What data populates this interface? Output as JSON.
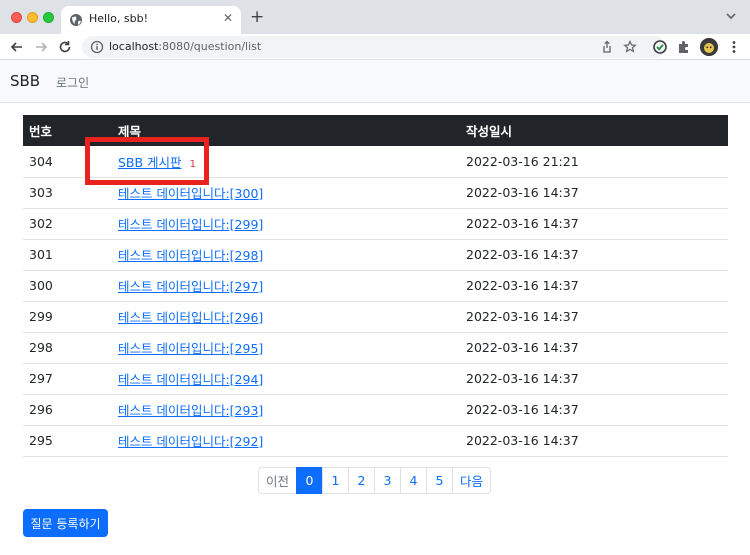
{
  "browser": {
    "tab_title": "Hello, sbb!",
    "tab_close": "✕",
    "new_tab": "+",
    "url_host": "localhost",
    "url_path": ":8080/question/list"
  },
  "navbar": {
    "brand": "SBB",
    "login": "로그인"
  },
  "table": {
    "headers": {
      "number": "번호",
      "subject": "제목",
      "created": "작성일시"
    },
    "rows": [
      {
        "number": "304",
        "subject": "SBB 게시판",
        "answers": "1",
        "created": "2022-03-16 21:21"
      },
      {
        "number": "303",
        "subject": "테스트 데이터입니다:[300]",
        "answers": "",
        "created": "2022-03-16 14:37"
      },
      {
        "number": "302",
        "subject": "테스트 데이터입니다:[299]",
        "answers": "",
        "created": "2022-03-16 14:37"
      },
      {
        "number": "301",
        "subject": "테스트 데이터입니다:[298]",
        "answers": "",
        "created": "2022-03-16 14:37"
      },
      {
        "number": "300",
        "subject": "테스트 데이터입니다:[297]",
        "answers": "",
        "created": "2022-03-16 14:37"
      },
      {
        "number": "299",
        "subject": "테스트 데이터입니다:[296]",
        "answers": "",
        "created": "2022-03-16 14:37"
      },
      {
        "number": "298",
        "subject": "테스트 데이터입니다:[295]",
        "answers": "",
        "created": "2022-03-16 14:37"
      },
      {
        "number": "297",
        "subject": "테스트 데이터입니다:[294]",
        "answers": "",
        "created": "2022-03-16 14:37"
      },
      {
        "number": "296",
        "subject": "테스트 데이터입니다:[293]",
        "answers": "",
        "created": "2022-03-16 14:37"
      },
      {
        "number": "295",
        "subject": "테스트 데이터입니다:[292]",
        "answers": "",
        "created": "2022-03-16 14:37"
      }
    ]
  },
  "pagination": {
    "prev": "이전",
    "pages": [
      "0",
      "1",
      "2",
      "3",
      "4",
      "5"
    ],
    "active": "0",
    "next": "다음"
  },
  "ask_button": "질문 등록하기",
  "colors": {
    "primary": "#0d6efd",
    "table_header": "#212529",
    "answer_badge": "#dc3545",
    "highlight_box": "#e8231f"
  }
}
